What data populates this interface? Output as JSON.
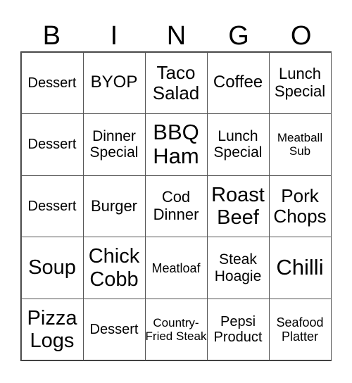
{
  "header": [
    "B",
    "I",
    "N",
    "G",
    "O"
  ],
  "grid": [
    [
      "Dessert",
      "BYOP",
      "Taco Salad",
      "Coffee",
      "Lunch Special"
    ],
    [
      "Dessert",
      "Dinner Special",
      "BBQ Ham",
      "Lunch Special",
      "Meatball Sub"
    ],
    [
      "Dessert",
      "Burger",
      "Cod Dinner",
      "Roast Beef",
      "Pork Chops"
    ],
    [
      "Soup",
      "Chick Cobb",
      "Meatloaf",
      "Steak Hoagie",
      "Chilli"
    ],
    [
      "Pizza Logs",
      "Dessert",
      "Country-Fried Steak",
      "Pepsi Product",
      "Seafood Platter"
    ]
  ]
}
